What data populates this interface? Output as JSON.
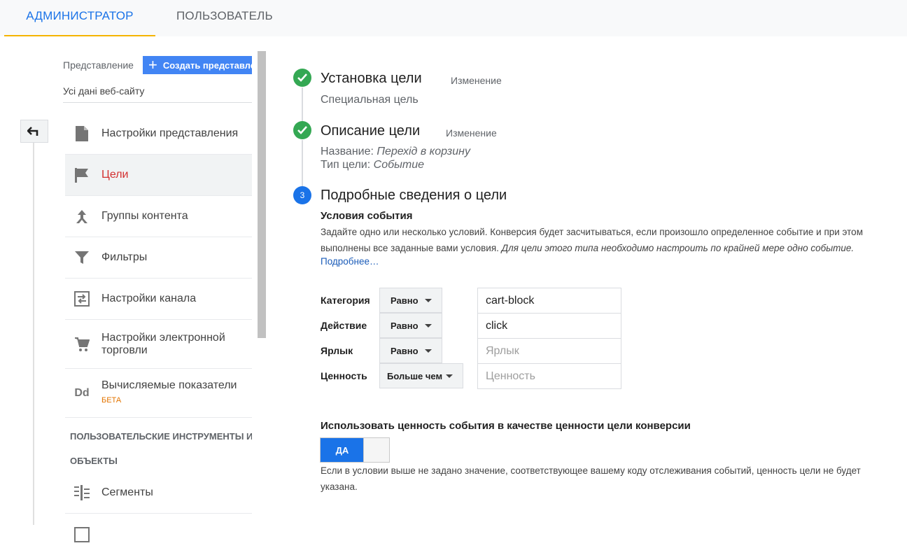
{
  "tabs": {
    "admin": "АДМИНИСТРАТОР",
    "user": "ПОЛЬЗОВАТЕЛЬ"
  },
  "sidebar": {
    "view_label": "Представление",
    "create_view": "Создать представление",
    "current_view": "Усі дані веб-сайту",
    "items": [
      {
        "label": "Настройки представления",
        "icon": "document-icon"
      },
      {
        "label": "Цели",
        "icon": "flag-icon"
      },
      {
        "label": "Группы контента",
        "icon": "content-groups-icon"
      },
      {
        "label": "Фильтры",
        "icon": "filter-icon"
      },
      {
        "label": "Настройки канала",
        "icon": "channel-settings-icon"
      },
      {
        "label": "Настройки электронной торговли",
        "icon": "cart-icon"
      },
      {
        "label": "Вычисляемые показатели",
        "badge": "БЕТА",
        "icon": "dd-icon"
      }
    ],
    "section_title_1": "ПОЛЬЗОВАТЕЛЬСКИЕ ИНСТРУМЕНТЫ И",
    "section_title_2": "ОБЪЕКТЫ",
    "segments": {
      "label": "Сегменты",
      "icon": "segments-icon"
    }
  },
  "steps": {
    "step1": {
      "title": "Установка цели",
      "edit": "Изменение",
      "detail": "Специальная цель"
    },
    "step2": {
      "title": "Описание цели",
      "edit": "Изменение",
      "name_label": "Название:",
      "name_value": "Перехід в корзину",
      "type_label": "Тип цели:",
      "type_value": "Событие"
    },
    "step3": {
      "number": "3",
      "title": "Подробные сведения о цели"
    }
  },
  "conditions": {
    "title": "Условия события",
    "desc_plain": "Задайте одно или несколько условий. Конверсия будет засчитываться, если произошло определенное событие и при этом выполнены все заданные вами условия. ",
    "desc_italic": "Для цели этого типа необходимо настроить по крайней мере одно событие.",
    "more": "Подробнее…",
    "rows": [
      {
        "label": "Категория",
        "op": "Равно",
        "value": "cart-block",
        "placeholder": ""
      },
      {
        "label": "Действие",
        "op": "Равно",
        "value": "click",
        "placeholder": ""
      },
      {
        "label": "Ярлык",
        "op": "Равно",
        "value": "",
        "placeholder": "Ярлык"
      },
      {
        "label": "Ценность",
        "op": "Больше чем",
        "value": "",
        "placeholder": "Ценность"
      }
    ]
  },
  "use_value": {
    "title": "Использовать ценность события в качестве ценности цели конверсии",
    "toggle": "ДА",
    "note": "Если в условии выше не задано значение, соответствующее вашему коду отслеживания событий, ценность цели не будет указана."
  },
  "colors": {
    "accent": "#1a73e8",
    "active_nav": "#d32f2f",
    "done": "#34a853",
    "tab_underline": "#f4b400",
    "beta": "#e37400"
  }
}
